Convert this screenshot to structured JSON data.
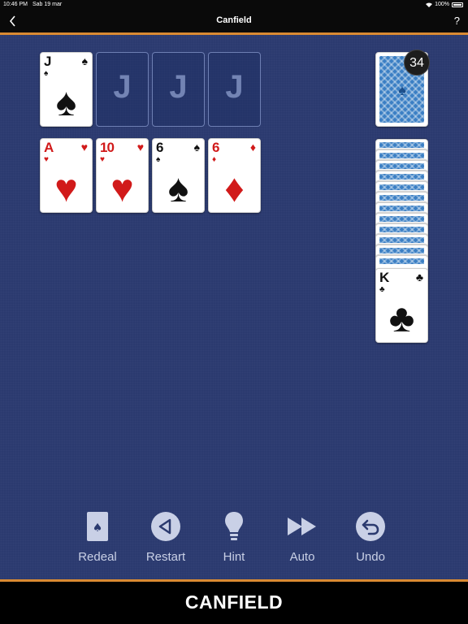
{
  "status": {
    "time": "10:46 PM",
    "date": "Sab 19 mar",
    "battery": "100%"
  },
  "nav": {
    "title": "Canfield",
    "help": "?"
  },
  "foundations": [
    {
      "type": "card",
      "rank": "J",
      "suit": "♠",
      "color": "black"
    },
    {
      "type": "empty",
      "label": "J"
    },
    {
      "type": "empty",
      "label": "J"
    },
    {
      "type": "empty",
      "label": "J"
    }
  ],
  "tableau": [
    {
      "rank": "A",
      "suit": "♥",
      "color": "red"
    },
    {
      "rank": "10",
      "suit": "♥",
      "color": "red"
    },
    {
      "rank": "6",
      "suit": "♠",
      "color": "black"
    },
    {
      "rank": "6",
      "suit": "♦",
      "color": "red"
    }
  ],
  "stock": {
    "count": "34"
  },
  "reserve": {
    "top_card": {
      "rank": "K",
      "suit": "♣",
      "color": "black"
    },
    "hidden_cards": 12
  },
  "toolbar": {
    "redeal": "Redeal",
    "restart": "Restart",
    "hint": "Hint",
    "auto": "Auto",
    "undo": "Undo"
  },
  "footer": {
    "title": "CANFIELD"
  },
  "colors": {
    "table": "#2b3a6f",
    "accent": "#d98a33",
    "red_suit": "#d11a1a"
  }
}
